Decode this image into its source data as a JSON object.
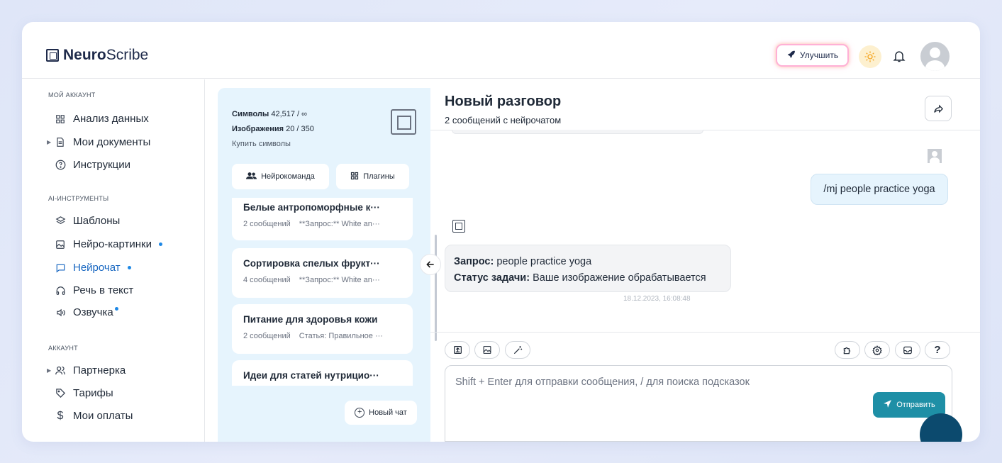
{
  "brand": {
    "bold": "Neuro",
    "regular": "Scribe"
  },
  "header": {
    "upgrade_label": "Улучшить"
  },
  "sidebar": {
    "sections": [
      {
        "title": "МОЙ АККАУНТ",
        "items": [
          {
            "label": "Анализ данных",
            "icon": "grid-icon"
          },
          {
            "label": "Мои документы",
            "icon": "document-icon",
            "expandable": true
          },
          {
            "label": "Инструкции",
            "icon": "question-icon"
          }
        ]
      },
      {
        "title": "AI-ИНСТРУМЕНТЫ",
        "items": [
          {
            "label": "Шаблоны",
            "icon": "layers-icon"
          },
          {
            "label": "Нейро-картинки",
            "icon": "image-icon",
            "dot": true
          },
          {
            "label": "Нейрочат",
            "icon": "chat-icon",
            "dot": true,
            "active": true
          },
          {
            "label": "Речь в текст",
            "icon": "headphones-icon"
          },
          {
            "label": "Озвучка",
            "icon": "speaker-icon",
            "dot": true
          }
        ]
      },
      {
        "title": "АККАУНТ",
        "items": [
          {
            "label": "Партнерка",
            "icon": "users-icon",
            "expandable": true
          },
          {
            "label": "Тарифы",
            "icon": "tag-icon"
          },
          {
            "label": "Мои оплаты",
            "icon": "dollar-icon"
          }
        ]
      }
    ]
  },
  "stats": {
    "symbols_label": "Символы",
    "symbols_value": "42,517 / ∞",
    "images_label": "Изображения",
    "images_value": "20 / 350",
    "buy_label": "Купить символы"
  },
  "panel": {
    "team_label": "Нейрокоманда",
    "plugins_label": "Плагины",
    "new_chat_label": "Новый чат"
  },
  "chats": [
    {
      "title": "Белые антропоморфные к···",
      "count": "2 сообщений",
      "preview": "**Запрос:** White an···"
    },
    {
      "title": "Сортировка спелых фрукт···",
      "count": "4 сообщений",
      "preview": "**Запрос:** White an···"
    },
    {
      "title": "Питание для здоровья кожи",
      "count": "2 сообщений",
      "preview": "Статья: Правильное ···"
    },
    {
      "title": "Идеи для статей нутрицио···",
      "count": "",
      "preview": ""
    }
  ],
  "conversation": {
    "title": "Новый разговор",
    "subtitle": "2 сообщений с нейрочатом",
    "user_message": "/mj people practice yoga",
    "bot_query_label": "Запрос:",
    "bot_query_value": "people practice yoga",
    "bot_status_label": "Статус задачи:",
    "bot_status_value": "Ваше изображение обрабатывается",
    "timestamp": "18.12.2023, 16:08:48"
  },
  "composer": {
    "placeholder": "Shift + Enter для отправки сообщения, / для поиска подсказок",
    "send_label": "Отправить",
    "help_label": "?"
  },
  "colors": {
    "accent": "#1565c0",
    "send": "#1e8fa6",
    "panel_bg": "#e6f4fd",
    "dot": "#1e88e5"
  }
}
